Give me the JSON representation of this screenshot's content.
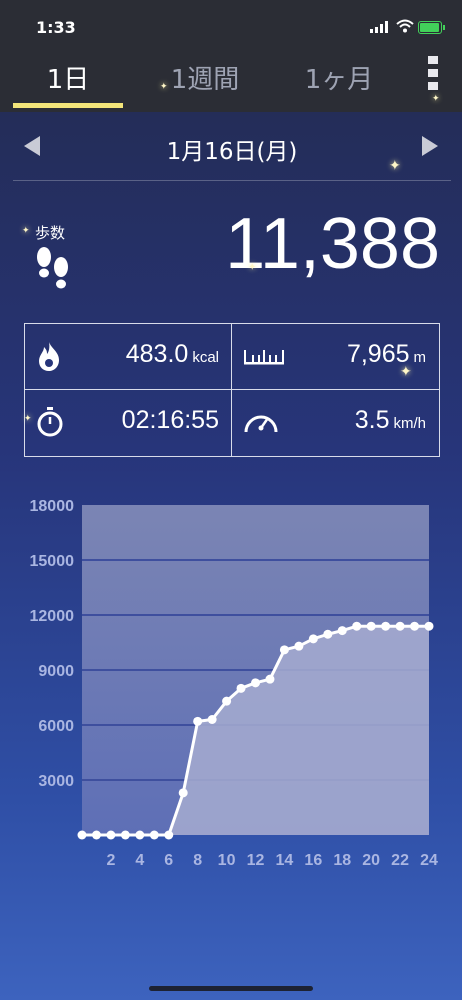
{
  "status_bar": {
    "time": "1:33"
  },
  "tabs": [
    {
      "label": "1日",
      "active": true
    },
    {
      "label": "1週間",
      "active": false
    },
    {
      "label": "1ヶ月",
      "active": false
    }
  ],
  "date": {
    "label": "1月16日(月)"
  },
  "steps": {
    "label": "歩数",
    "value": "11,388"
  },
  "stats": {
    "calories": {
      "value": "483.0",
      "unit": "kcal"
    },
    "distance": {
      "value": "7,965",
      "unit": "m"
    },
    "duration": {
      "value": "02:16:55"
    },
    "speed": {
      "value": "3.5",
      "unit": "km/h"
    }
  },
  "colors": {
    "accent": "#f3e57a",
    "chart_fill": "#a6acd0",
    "line": "#ffffff"
  },
  "chart_data": {
    "type": "line",
    "title": "",
    "xlabel": "",
    "ylabel": "",
    "ylim": [
      0,
      18000
    ],
    "xlim": [
      0,
      24
    ],
    "y_ticks": [
      3000,
      6000,
      9000,
      12000,
      15000,
      18000
    ],
    "x_ticks": [
      2,
      4,
      6,
      8,
      10,
      12,
      14,
      16,
      18,
      20,
      22,
      24
    ],
    "grid": true,
    "x": [
      0,
      1,
      2,
      3,
      4,
      5,
      6,
      7,
      8,
      9,
      10,
      11,
      12,
      13,
      14,
      15,
      16,
      17,
      18,
      19,
      20,
      21,
      22,
      23,
      24
    ],
    "series": [
      {
        "values": [
          0,
          0,
          0,
          0,
          0,
          0,
          0,
          2300,
          6200,
          6300,
          7300,
          8000,
          8300,
          8500,
          10100,
          10300,
          10700,
          10950,
          11150,
          11388,
          11388,
          11388,
          11388,
          11388,
          11388
        ]
      }
    ]
  }
}
